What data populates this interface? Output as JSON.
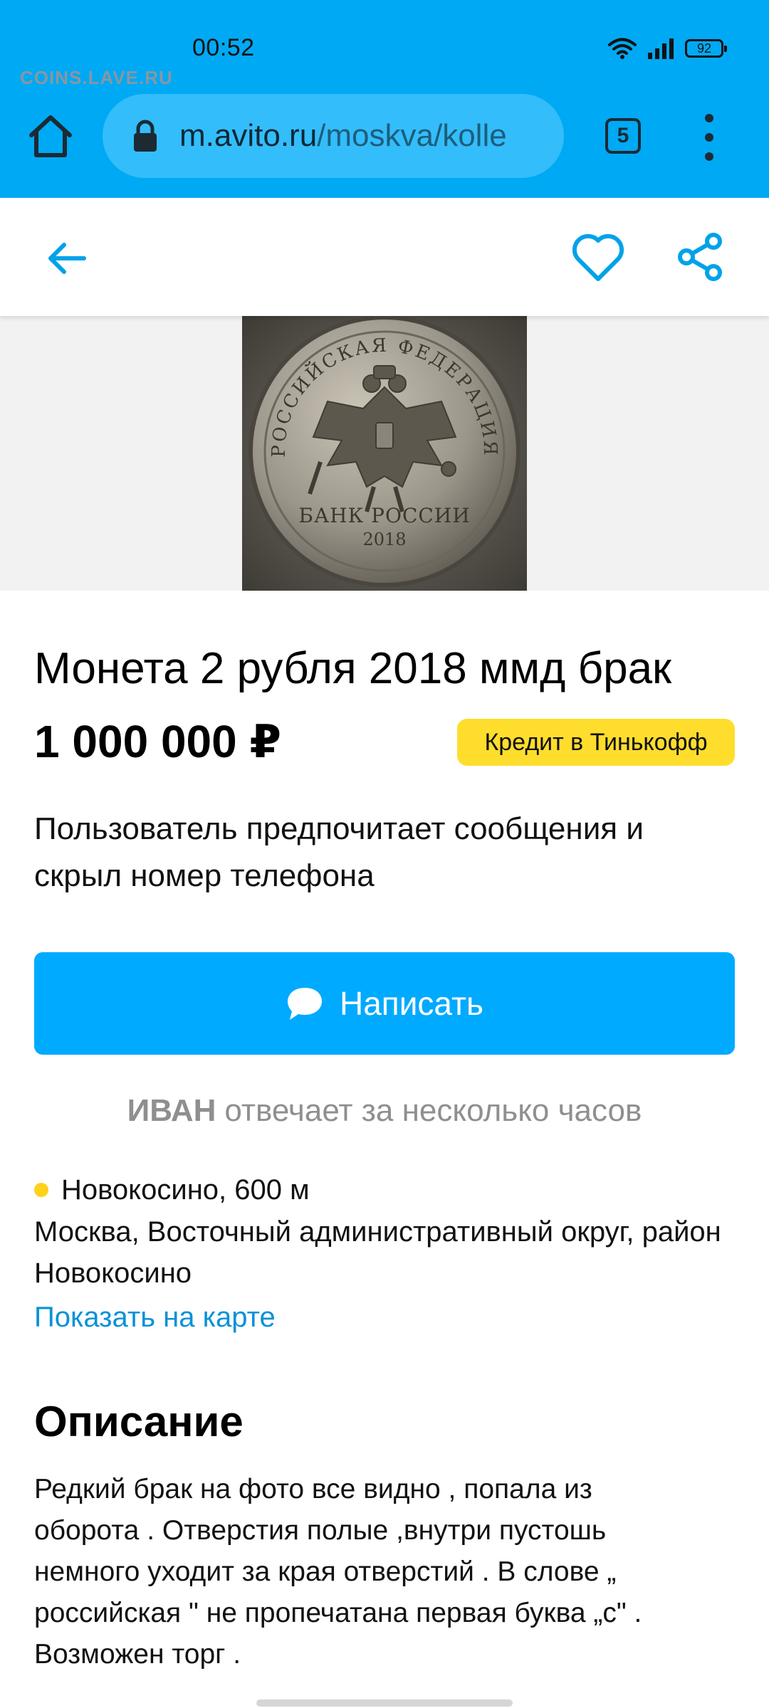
{
  "status_bar": {
    "time": "00:52",
    "battery": "92",
    "icons": [
      "wifi-icon",
      "signal-icon",
      "battery-icon"
    ]
  },
  "watermark": "COINS.LAVE.RU",
  "browser": {
    "url_host": "m.avito.ru",
    "url_path": "/moskva/kolle",
    "tab_count": "5",
    "accent_color": "#00a9f4",
    "icons": [
      "home-icon",
      "lock-icon",
      "more-vertical-icon"
    ]
  },
  "app_bar": {
    "icons": [
      "arrow-back-icon",
      "heart-icon",
      "share-icon"
    ],
    "icon_color": "#00a3e8"
  },
  "listing": {
    "title": "Монета 2 рубля 2018 ммд брак",
    "price": "1 000 000 ₽",
    "credit_badge": "Кредит в Тинькофф",
    "contact_notice": "Пользователь предпочитает сообщения и скрыл номер телефона",
    "write_button": "Написать",
    "seller_name": "ИВАН",
    "seller_response": "отвечает за несколько часов",
    "metro": "Новокосино, 600 м",
    "address": "Москва, Восточный административный округ, район Новокосино",
    "map_link": "Показать на карте",
    "description_heading": "Описание",
    "description": "Редкий брак на фото все видно , попала из\nоборота . Отверстия полые ,внутри пустошь\nнемного уходит за края отверстий . В слове „\nроссийская \" не пропечатана первая буква „с\" .\nВозможен торг ."
  },
  "photo": {
    "coin_inscription_top": "РОССИЙСКАЯ ФЕДЕРАЦИЯ",
    "coin_inscription_bottom": "БАНК РОССИИ",
    "coin_year": "2018"
  }
}
